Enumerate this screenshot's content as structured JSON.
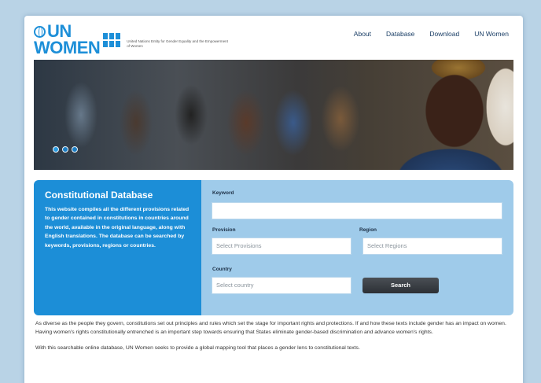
{
  "header": {
    "logo_line1": "UN",
    "logo_line2": "WOMEN",
    "logo_subtitle": "United Nations Entity for Gender Equality and the Empowerment of Women",
    "nav": [
      "About",
      "Database",
      "Download",
      "UN Women"
    ]
  },
  "hero": {
    "slide_count": 3,
    "active_slide": 1
  },
  "panel": {
    "title": "Constitutional Database",
    "description": "This website compiles all the different provisions related to gender contained in constitutions in countries around the world, available in the original language, along with English translations. The database can be searched by keywords, provisions, regions or countries.",
    "keyword_label": "Keyword",
    "keyword_value": "",
    "provision_label": "Provision",
    "provision_placeholder": "Select Provisions",
    "region_label": "Region",
    "region_placeholder": "Select Regions",
    "country_label": "Country",
    "country_placeholder": "Select country",
    "search_label": "Search"
  },
  "body": {
    "para1": "As diverse as the people they govern, constitutions set out principles and rules which set the stage for important rights and protections. If and how these texts include gender has an impact on women. Having women's rights constitutionally entrenched is an important step towards ensuring that States eliminate gender-based discrimination and advance women's rights.",
    "para2": "With this searchable online database, UN Women seeks to provide a global mapping tool that places a gender lens to constitutional texts."
  },
  "colors": {
    "brand_blue": "#1c8ed7",
    "panel_light": "#9fcbea",
    "button_dark": "#2c3035",
    "page_bg": "#b9d3e6"
  }
}
